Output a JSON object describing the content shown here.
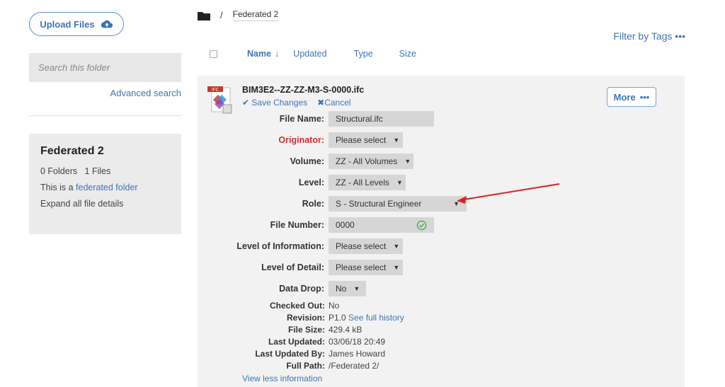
{
  "sidebar": {
    "upload_label": "Upload Files",
    "search_placeholder": "Search this folder",
    "advanced_search": "Advanced search",
    "folder_title": "Federated 2",
    "folders_count": "0 Folders",
    "files_count": "1 Files",
    "federated_prefix": "This is a ",
    "federated_link": "federated folder",
    "expand_all": "Expand all file details"
  },
  "breadcrumb": {
    "separator": "/",
    "current": "Federated 2"
  },
  "filter_tags": "Filter by Tags •••",
  "columns": {
    "name": "Name",
    "sort_arrow": "↓",
    "updated": "Updated",
    "type": "Type",
    "size": "Size"
  },
  "file": {
    "icon_label": "IFC",
    "title": "BIM3E2--ZZ-ZZ-M3-S-0000.ifc",
    "save_changes": "Save Changes",
    "cancel": "Cancel",
    "more_label": "More",
    "more_dots": "•••",
    "fields": [
      {
        "label": "File Name:",
        "value": "Structural.ifc",
        "required": false
      },
      {
        "label": "Originator:",
        "value": "Please select",
        "required": true
      },
      {
        "label": "Volume:",
        "value": "ZZ - All Volumes",
        "required": false
      },
      {
        "label": "Level:",
        "value": "ZZ - All Levels",
        "required": false
      },
      {
        "label": "Role:",
        "value": "S - Structural Engineer",
        "required": false
      },
      {
        "label": "File Number:",
        "value": "0000",
        "required": false
      },
      {
        "label": "Level of Information:",
        "value": "Please select",
        "required": false
      },
      {
        "label": "Level of Detail:",
        "value": "Please select",
        "required": false
      },
      {
        "label": "Data Drop:",
        "value": "No",
        "required": false
      }
    ],
    "meta": {
      "checked_out_label": "Checked Out:",
      "checked_out": "No",
      "revision_label": "Revision:",
      "revision": "P1.0",
      "history_link": "See full history",
      "file_size_label": "File Size:",
      "file_size": "429.4 kB",
      "last_updated_label": "Last Updated:",
      "last_updated": "03/06/18 20:49",
      "updated_by_label": "Last Updated By:",
      "updated_by": "James Howard",
      "full_path_label": "Full Path:",
      "full_path": "/Federated 2/"
    },
    "view_less": "View less information"
  },
  "colors": {
    "link": "#3f74b6",
    "required": "#d62e2e",
    "valid": "#4caf50",
    "annotation_arrow": "#e02020"
  },
  "icons": [
    "cloud-upload-icon",
    "folder-icon",
    "ifc-file-icon",
    "check-icon",
    "cancel-x-icon",
    "valid-check-icon",
    "caret-down-icon"
  ]
}
